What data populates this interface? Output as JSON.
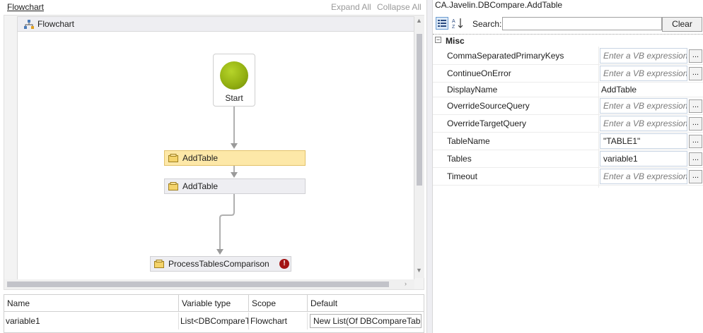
{
  "designer": {
    "breadcrumb": "Flowchart",
    "expand_all": "Expand All",
    "collapse_all": "Collapse All",
    "flowchart_title": "Flowchart",
    "start_label": "Start",
    "activities": [
      {
        "label": "AddTable"
      },
      {
        "label": "AddTable"
      },
      {
        "label": "ProcessTablesComparison"
      }
    ]
  },
  "variables": {
    "headers": [
      "Name",
      "Variable type",
      "Scope",
      "Default"
    ],
    "rows": [
      {
        "name": "variable1",
        "type": "List<DBCompareT",
        "scope": "Flowchart",
        "default": "New List(Of DBCompareTabl"
      }
    ]
  },
  "properties": {
    "title": "CA.Javelin.DBCompare.AddTable",
    "search_label": "Search:",
    "search_value": "",
    "clear_label": "Clear",
    "category": "Misc",
    "items": [
      {
        "name": "CommaSeparatedPrimaryKeys",
        "value": "Enter a VB expression"
      },
      {
        "name": "ContinueOnError",
        "value": "Enter a VB expression"
      },
      {
        "name": "DisplayName",
        "value": "AddTable"
      },
      {
        "name": "OverrideSourceQuery",
        "value": "Enter a VB expression"
      },
      {
        "name": "OverrideTargetQuery",
        "value": "Enter a VB expression"
      },
      {
        "name": "TableName",
        "value": "\"TABLE1\""
      },
      {
        "name": "Tables",
        "value": "variable1"
      },
      {
        "name": "Timeout",
        "value": "Enter a VB expression"
      }
    ],
    "ellipsis": "..."
  },
  "colors": {
    "selected_activity": "#fde8a8",
    "activity": "#eeeef2",
    "start_circle": "#94b112",
    "error": "#a31515"
  }
}
